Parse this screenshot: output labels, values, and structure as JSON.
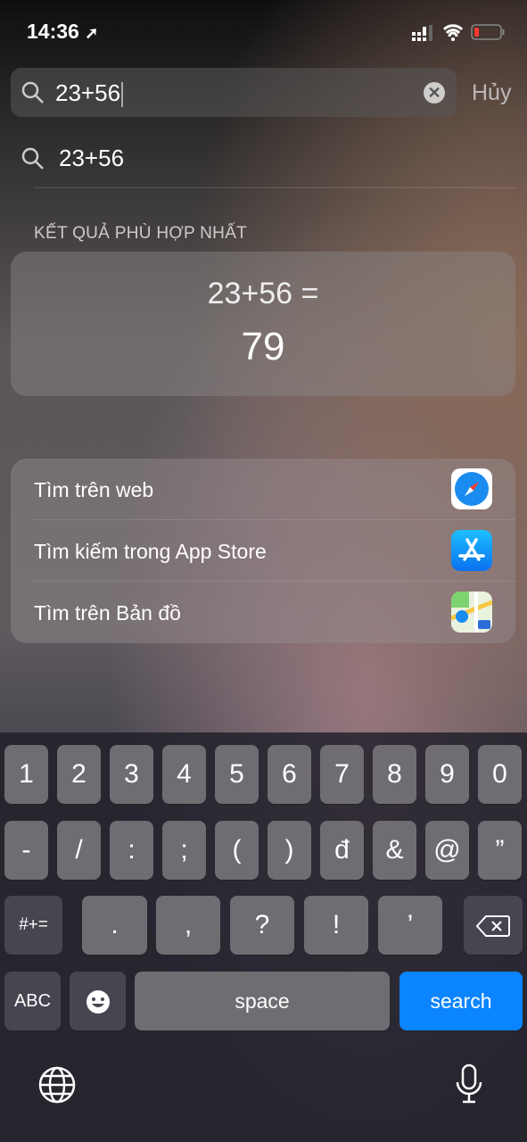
{
  "status": {
    "time": "14:36",
    "icons": [
      "location-arrow-icon",
      "signal-icon",
      "wifi-icon",
      "battery-low-icon"
    ],
    "battery_color": "#ff3b30"
  },
  "search": {
    "value": "23+56",
    "cancel_label": "Hủy"
  },
  "suggestion": {
    "text": "23+56"
  },
  "top_hit": {
    "section_title": "KẾT QUẢ PHÙ HỢP NHẤT",
    "expression": "23+56 =",
    "result": "79"
  },
  "actions": [
    {
      "label": "Tìm trên web",
      "icon": "safari-icon"
    },
    {
      "label": "Tìm kiếm trong App Store",
      "icon": "app-store-icon"
    },
    {
      "label": "Tìm trên Bản đồ",
      "icon": "maps-icon"
    }
  ],
  "keyboard": {
    "row1": [
      "1",
      "2",
      "3",
      "4",
      "5",
      "6",
      "7",
      "8",
      "9",
      "0"
    ],
    "row2": [
      "-",
      "/",
      ":",
      ";",
      "(",
      ")",
      "đ",
      "&",
      "@",
      "”"
    ],
    "row3": [
      "#+=",
      ".",
      ",",
      "?",
      "!",
      "’"
    ],
    "abc": "ABC",
    "space": "space",
    "search": "search",
    "accent": "#0a84ff"
  }
}
